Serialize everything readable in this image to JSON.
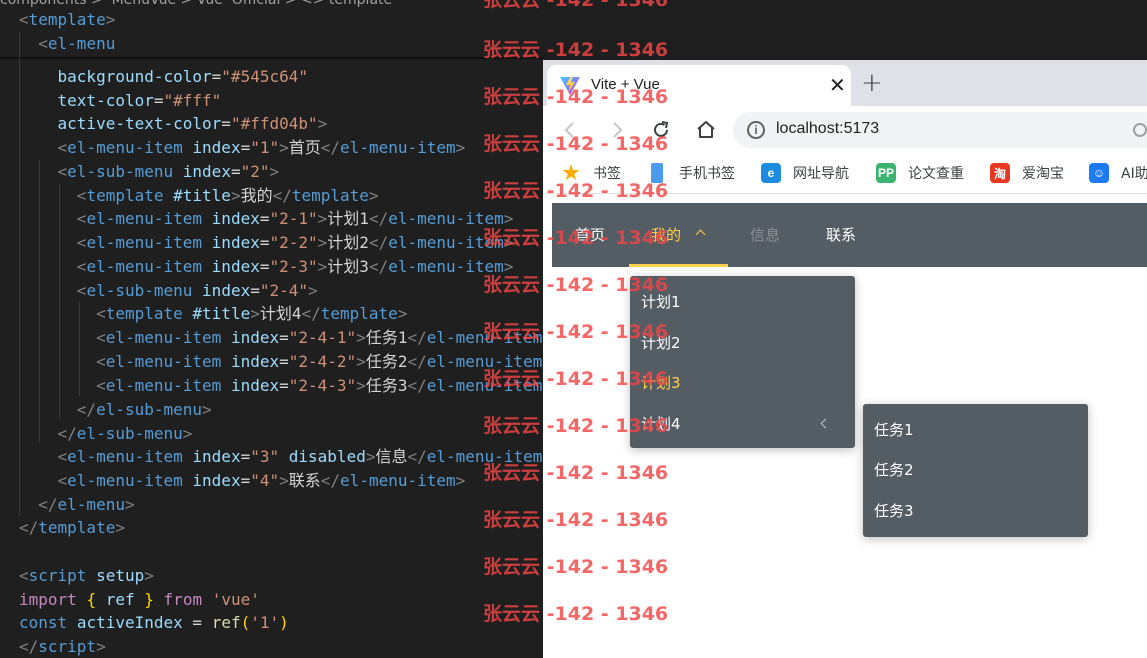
{
  "editor": {
    "breadcrumb": "components >  MenuVue > Vue  Official > <> template",
    "lines": [
      [
        [
          "t-bracket",
          "<"
        ],
        [
          "t-tag",
          "template"
        ],
        [
          "t-bracket",
          ">"
        ]
      ],
      [
        [
          "t-text",
          "  "
        ],
        [
          "t-bracket",
          "<"
        ],
        [
          "t-tag",
          "el-menu"
        ]
      ],
      [
        [
          "t-text",
          "    "
        ],
        [
          "t-attr",
          "background-color"
        ],
        [
          "t-text",
          "="
        ],
        [
          "t-str",
          "\"#545c64\""
        ]
      ],
      [
        [
          "t-text",
          "    "
        ],
        [
          "t-attr",
          "text-color"
        ],
        [
          "t-text",
          "="
        ],
        [
          "t-str",
          "\"#fff\""
        ]
      ],
      [
        [
          "t-text",
          "    "
        ],
        [
          "t-attr",
          "active-text-color"
        ],
        [
          "t-text",
          "="
        ],
        [
          "t-str",
          "\"#ffd04b\""
        ],
        [
          "t-bracket",
          ">"
        ]
      ],
      [
        [
          "t-text",
          "    "
        ],
        [
          "t-bracket",
          "<"
        ],
        [
          "t-tag",
          "el-menu-item"
        ],
        [
          "t-text",
          " "
        ],
        [
          "t-attr",
          "index"
        ],
        [
          "t-text",
          "="
        ],
        [
          "t-str",
          "\"1\""
        ],
        [
          "t-bracket",
          ">"
        ],
        [
          "t-text",
          "首页"
        ],
        [
          "t-bracket",
          "</"
        ],
        [
          "t-tag",
          "el-menu-item"
        ],
        [
          "t-bracket",
          ">"
        ]
      ],
      [
        [
          "t-text",
          "    "
        ],
        [
          "t-bracket",
          "<"
        ],
        [
          "t-tag",
          "el-sub-menu"
        ],
        [
          "t-text",
          " "
        ],
        [
          "t-attr",
          "index"
        ],
        [
          "t-text",
          "="
        ],
        [
          "t-str",
          "\"2\""
        ],
        [
          "t-bracket",
          ">"
        ]
      ],
      [
        [
          "t-text",
          "      "
        ],
        [
          "t-bracket",
          "<"
        ],
        [
          "t-tag",
          "template"
        ],
        [
          "t-text",
          " "
        ],
        [
          "t-attr",
          "#title"
        ],
        [
          "t-bracket",
          ">"
        ],
        [
          "t-text",
          "我的"
        ],
        [
          "t-bracket",
          "</"
        ],
        [
          "t-tag",
          "template"
        ],
        [
          "t-bracket",
          ">"
        ]
      ],
      [
        [
          "t-text",
          "      "
        ],
        [
          "t-bracket",
          "<"
        ],
        [
          "t-tag",
          "el-menu-item"
        ],
        [
          "t-text",
          " "
        ],
        [
          "t-attr",
          "index"
        ],
        [
          "t-text",
          "="
        ],
        [
          "t-str",
          "\"2-1\""
        ],
        [
          "t-bracket",
          ">"
        ],
        [
          "t-text",
          "计划1"
        ],
        [
          "t-bracket",
          "</"
        ],
        [
          "t-tag",
          "el-menu-item"
        ],
        [
          "t-bracket",
          ">"
        ]
      ],
      [
        [
          "t-text",
          "      "
        ],
        [
          "t-bracket",
          "<"
        ],
        [
          "t-tag",
          "el-menu-item"
        ],
        [
          "t-text",
          " "
        ],
        [
          "t-attr",
          "index"
        ],
        [
          "t-text",
          "="
        ],
        [
          "t-str",
          "\"2-2\""
        ],
        [
          "t-bracket",
          ">"
        ],
        [
          "t-text",
          "计划2"
        ],
        [
          "t-bracket",
          "</"
        ],
        [
          "t-tag",
          "el-menu-item"
        ],
        [
          "t-bracket",
          ">"
        ]
      ],
      [
        [
          "t-text",
          "      "
        ],
        [
          "t-bracket",
          "<"
        ],
        [
          "t-tag",
          "el-menu-item"
        ],
        [
          "t-text",
          " "
        ],
        [
          "t-attr",
          "index"
        ],
        [
          "t-text",
          "="
        ],
        [
          "t-str",
          "\"2-3\""
        ],
        [
          "t-bracket",
          ">"
        ],
        [
          "t-text",
          "计划3"
        ],
        [
          "t-bracket",
          "</"
        ],
        [
          "t-tag",
          "el-menu-item"
        ],
        [
          "t-bracket",
          ">"
        ]
      ],
      [
        [
          "t-text",
          "      "
        ],
        [
          "t-bracket",
          "<"
        ],
        [
          "t-tag",
          "el-sub-menu"
        ],
        [
          "t-text",
          " "
        ],
        [
          "t-attr",
          "index"
        ],
        [
          "t-text",
          "="
        ],
        [
          "t-str",
          "\"2-4\""
        ],
        [
          "t-bracket",
          ">"
        ]
      ],
      [
        [
          "t-text",
          "        "
        ],
        [
          "t-bracket",
          "<"
        ],
        [
          "t-tag",
          "template"
        ],
        [
          "t-text",
          " "
        ],
        [
          "t-attr",
          "#title"
        ],
        [
          "t-bracket",
          ">"
        ],
        [
          "t-text",
          "计划4"
        ],
        [
          "t-bracket",
          "</"
        ],
        [
          "t-tag",
          "template"
        ],
        [
          "t-bracket",
          ">"
        ]
      ],
      [
        [
          "t-text",
          "        "
        ],
        [
          "t-bracket",
          "<"
        ],
        [
          "t-tag",
          "el-menu-item"
        ],
        [
          "t-text",
          " "
        ],
        [
          "t-attr",
          "index"
        ],
        [
          "t-text",
          "="
        ],
        [
          "t-str",
          "\"2-4-1\""
        ],
        [
          "t-bracket",
          ">"
        ],
        [
          "t-text",
          "任务1"
        ],
        [
          "t-bracket",
          "</"
        ],
        [
          "t-tag",
          "el-menu-item"
        ],
        [
          "t-bracket",
          ">"
        ]
      ],
      [
        [
          "t-text",
          "        "
        ],
        [
          "t-bracket",
          "<"
        ],
        [
          "t-tag",
          "el-menu-item"
        ],
        [
          "t-text",
          " "
        ],
        [
          "t-attr",
          "index"
        ],
        [
          "t-text",
          "="
        ],
        [
          "t-str",
          "\"2-4-2\""
        ],
        [
          "t-bracket",
          ">"
        ],
        [
          "t-text",
          "任务2"
        ],
        [
          "t-bracket",
          "</"
        ],
        [
          "t-tag",
          "el-menu-item"
        ],
        [
          "t-bracket",
          ">"
        ]
      ],
      [
        [
          "t-text",
          "        "
        ],
        [
          "t-bracket",
          "<"
        ],
        [
          "t-tag",
          "el-menu-item"
        ],
        [
          "t-text",
          " "
        ],
        [
          "t-attr",
          "index"
        ],
        [
          "t-text",
          "="
        ],
        [
          "t-str",
          "\"2-4-3\""
        ],
        [
          "t-bracket",
          ">"
        ],
        [
          "t-text",
          "任务3"
        ],
        [
          "t-bracket",
          "</"
        ],
        [
          "t-tag",
          "el-menu-item"
        ],
        [
          "t-bracket",
          ">"
        ]
      ],
      [
        [
          "t-text",
          "      "
        ],
        [
          "t-bracket",
          "</"
        ],
        [
          "t-tag",
          "el-sub-menu"
        ],
        [
          "t-bracket",
          ">"
        ]
      ],
      [
        [
          "t-text",
          "    "
        ],
        [
          "t-bracket",
          "</"
        ],
        [
          "t-tag",
          "el-sub-menu"
        ],
        [
          "t-bracket",
          ">"
        ]
      ],
      [
        [
          "t-text",
          "    "
        ],
        [
          "t-bracket",
          "<"
        ],
        [
          "t-tag",
          "el-menu-item"
        ],
        [
          "t-text",
          " "
        ],
        [
          "t-attr",
          "index"
        ],
        [
          "t-text",
          "="
        ],
        [
          "t-str",
          "\"3\""
        ],
        [
          "t-text",
          " "
        ],
        [
          "t-attr",
          "disabled"
        ],
        [
          "t-bracket",
          ">"
        ],
        [
          "t-text",
          "信息"
        ],
        [
          "t-bracket",
          "</"
        ],
        [
          "t-tag",
          "el-menu-item"
        ],
        [
          "t-bracket",
          ">"
        ]
      ],
      [
        [
          "t-text",
          "    "
        ],
        [
          "t-bracket",
          "<"
        ],
        [
          "t-tag",
          "el-menu-item"
        ],
        [
          "t-text",
          " "
        ],
        [
          "t-attr",
          "index"
        ],
        [
          "t-text",
          "="
        ],
        [
          "t-str",
          "\"4\""
        ],
        [
          "t-bracket",
          ">"
        ],
        [
          "t-text",
          "联系"
        ],
        [
          "t-bracket",
          "</"
        ],
        [
          "t-tag",
          "el-menu-item"
        ],
        [
          "t-bracket",
          ">"
        ]
      ],
      [
        [
          "t-text",
          "  "
        ],
        [
          "t-bracket",
          "</"
        ],
        [
          "t-tag",
          "el-menu"
        ],
        [
          "t-bracket",
          ">"
        ]
      ],
      [
        [
          "t-bracket",
          "</"
        ],
        [
          "t-tag",
          "template"
        ],
        [
          "t-bracket",
          ">"
        ]
      ],
      [],
      [
        [
          "t-bracket",
          "<"
        ],
        [
          "t-tag",
          "script"
        ],
        [
          "t-text",
          " "
        ],
        [
          "t-attr",
          "setup"
        ],
        [
          "t-bracket",
          ">"
        ]
      ],
      [
        [
          "t-kw",
          "import"
        ],
        [
          "t-text",
          " "
        ],
        [
          "t-brace",
          "{"
        ],
        [
          "t-text",
          " "
        ],
        [
          "t-var",
          "ref"
        ],
        [
          "t-text",
          " "
        ],
        [
          "t-brace",
          "}"
        ],
        [
          "t-text",
          " "
        ],
        [
          "t-kw",
          "from"
        ],
        [
          "t-text",
          " "
        ],
        [
          "t-str",
          "'vue'"
        ]
      ],
      [
        [
          "t-decl",
          "const"
        ],
        [
          "t-text",
          " "
        ],
        [
          "t-var",
          "activeIndex"
        ],
        [
          "t-text",
          " = "
        ],
        [
          "t-fn",
          "ref"
        ],
        [
          "t-brace",
          "("
        ],
        [
          "t-str",
          "'1'"
        ],
        [
          "t-brace",
          ")"
        ]
      ],
      [
        [
          "t-bracket",
          "</"
        ],
        [
          "t-tag",
          "script"
        ],
        [
          "t-bracket",
          ">"
        ]
      ]
    ]
  },
  "browser": {
    "tab_title": "Vite + Vue",
    "close_symbol": "✕",
    "new_tab_symbol": "+",
    "url": "localhost:5173",
    "bookmarks": [
      {
        "label": "书签",
        "icon": "star-icon",
        "color": "#f9ab00",
        "glyph": "★"
      },
      {
        "label": "手机书签",
        "icon": "phone-icon",
        "color": "#4b9cf0",
        "glyph": ""
      },
      {
        "label": "网址导航",
        "icon": "edge-icon",
        "color": "#1d8ce0",
        "glyph": "e"
      },
      {
        "label": "论文查重",
        "icon": "pp-icon",
        "color": "#3cb371",
        "glyph": "PP"
      },
      {
        "label": "爱淘宝",
        "icon": "taobao-icon",
        "color": "#e8381f",
        "glyph": "淘"
      },
      {
        "label": "AI助",
        "icon": "ai-icon",
        "color": "#1f7af5",
        "glyph": "☺"
      }
    ]
  },
  "menu": {
    "background": "#545c64",
    "text_color": "#ffffff",
    "active_text_color": "#ffd04b",
    "disabled_text_color": "#8a8f96",
    "items": [
      {
        "label": "首页",
        "state": "normal"
      },
      {
        "label": "我的",
        "state": "active-open"
      },
      {
        "label": "信息",
        "state": "disabled"
      },
      {
        "label": "联系",
        "state": "normal"
      }
    ],
    "submenu_items": [
      {
        "label": "计划1",
        "state": "normal"
      },
      {
        "label": "计划2",
        "state": "normal"
      },
      {
        "label": "计划3",
        "state": "active"
      },
      {
        "label": "计划4",
        "state": "open"
      }
    ],
    "nested_items": [
      {
        "label": "任务1"
      },
      {
        "label": "任务2"
      },
      {
        "label": "任务3"
      }
    ]
  },
  "watermark": {
    "text": "张云云 -142 - 1346",
    "color": "#f04646"
  }
}
